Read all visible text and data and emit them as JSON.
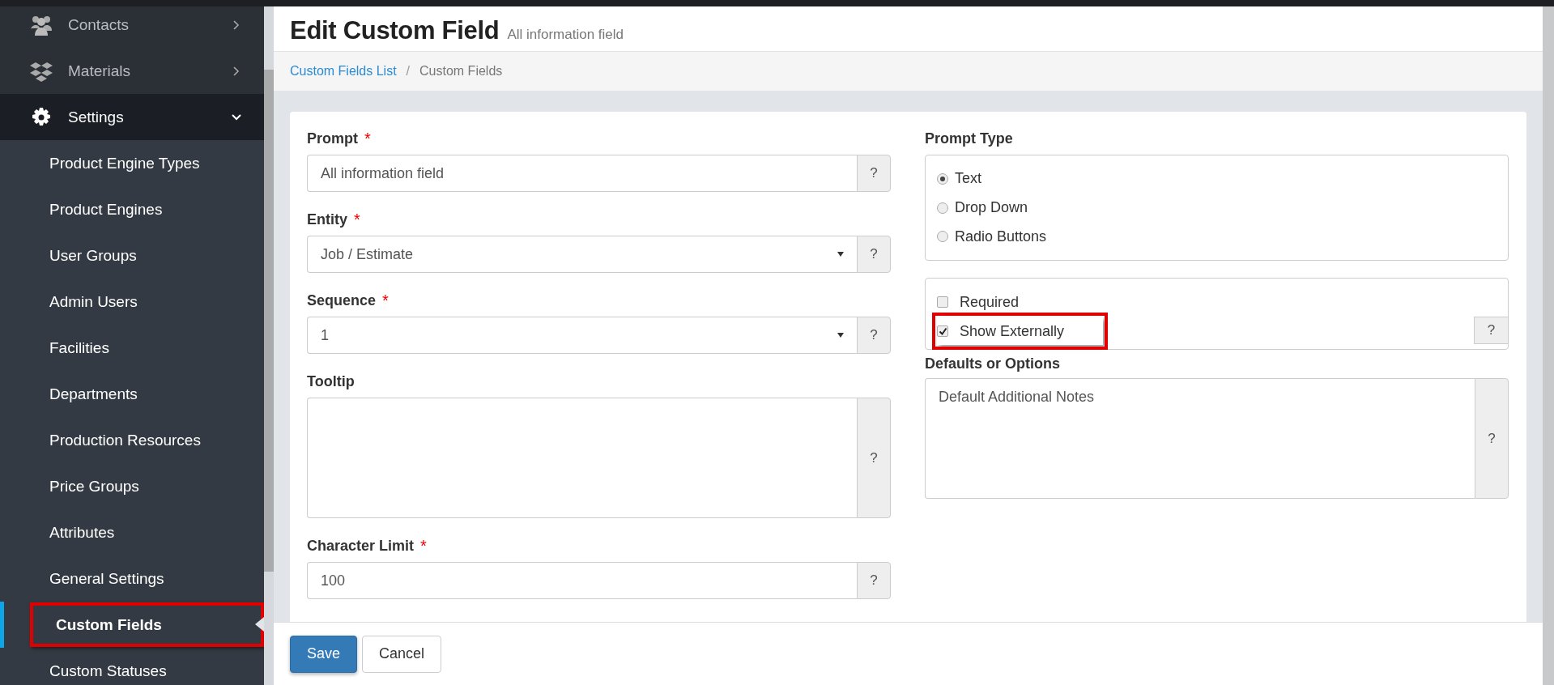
{
  "sidebar": {
    "items": [
      {
        "label": "Contacts",
        "kind": "people",
        "expanded": false
      },
      {
        "label": "Materials",
        "kind": "boxes",
        "expanded": false
      },
      {
        "label": "Settings",
        "kind": "gear",
        "expanded": true,
        "children": [
          {
            "label": "Product Engine Types",
            "selected": false,
            "highlighted": false
          },
          {
            "label": "Product Engines",
            "selected": false,
            "highlighted": false
          },
          {
            "label": "User Groups",
            "selected": false,
            "highlighted": false
          },
          {
            "label": "Admin Users",
            "selected": false,
            "highlighted": false
          },
          {
            "label": "Facilities",
            "selected": false,
            "highlighted": false
          },
          {
            "label": "Departments",
            "selected": false,
            "highlighted": false
          },
          {
            "label": "Production Resources",
            "selected": false,
            "highlighted": false
          },
          {
            "label": "Price Groups",
            "selected": false,
            "highlighted": false
          },
          {
            "label": "Attributes",
            "selected": false,
            "highlighted": false
          },
          {
            "label": "General Settings",
            "selected": false,
            "highlighted": false
          },
          {
            "label": "Custom Fields",
            "selected": true,
            "highlighted": true
          },
          {
            "label": "Custom Statuses",
            "selected": false,
            "highlighted": false
          }
        ]
      }
    ]
  },
  "page": {
    "title": "Edit Custom Field",
    "subtitle": "All information field"
  },
  "breadcrumb": {
    "separator": "/",
    "items": [
      {
        "label": "Custom Fields List",
        "link": true
      },
      {
        "label": "Custom Fields",
        "link": false
      }
    ]
  },
  "left_fields": [
    {
      "label": "Prompt",
      "required_mark": "*",
      "kind": "text",
      "value": "All information field",
      "help": "?"
    },
    {
      "label": "Entity",
      "required_mark": "*",
      "kind": "select",
      "value": "Job / Estimate",
      "help": "?"
    },
    {
      "label": "Sequence",
      "required_mark": "*",
      "kind": "select",
      "value": "1",
      "help": "?"
    },
    {
      "label": "Tooltip",
      "kind": "textarea",
      "help": "?"
    },
    {
      "label": "Character Limit",
      "required_mark": "*",
      "kind": "text",
      "value": "100",
      "help": "?"
    }
  ],
  "prompt_type": {
    "label": "Prompt Type",
    "options": [
      {
        "label": "Text",
        "selected": true
      },
      {
        "label": "Drop Down",
        "selected": false
      },
      {
        "label": "Radio Buttons",
        "selected": false
      }
    ]
  },
  "flags": {
    "help": "?",
    "options": [
      {
        "label": "Required",
        "checked": false,
        "highlighted": false
      },
      {
        "label": "Show Externally",
        "checked": true,
        "highlighted": true
      }
    ]
  },
  "defaults": {
    "label": "Defaults or Options",
    "value": "Default Additional Notes",
    "help": "?"
  },
  "buttons": [
    {
      "label": "Save",
      "kind": "primary"
    },
    {
      "label": "Cancel",
      "kind": "default"
    }
  ]
}
